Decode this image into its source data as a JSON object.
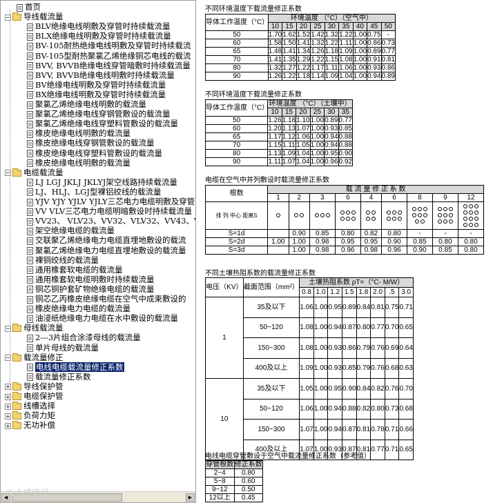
{
  "tree": {
    "items": [
      {
        "label": "首页",
        "level": 1,
        "type": "doc"
      },
      {
        "label": "导线载流量",
        "level": 0,
        "type": "folder",
        "expanded": true
      },
      {
        "label": "BLV绝缘电线明敷及穿管时持续载流量",
        "level": 2,
        "type": "doc"
      },
      {
        "label": "BLX绝缘电线明敷及穿管时持续载流量",
        "level": 2,
        "type": "doc"
      },
      {
        "label": "BV-105耐热绝缘电线明敷及穿管时持续载流",
        "level": 2,
        "type": "doc"
      },
      {
        "label": "BV-105型耐热聚氯乙烯绝缘铜芯电线的载流",
        "level": 2,
        "type": "doc"
      },
      {
        "label": "BVV, BVVB绝缘电线穿管暗敷时持续载流量",
        "level": 2,
        "type": "doc"
      },
      {
        "label": "BVV, BVVB绝缘电线明敷时持续载流量",
        "level": 2,
        "type": "doc"
      },
      {
        "label": "BV绝缘电线明敷及穿管时持续载流量",
        "level": 2,
        "type": "doc"
      },
      {
        "label": "BX绝缘电线明敷及穿管时持续载流量",
        "level": 2,
        "type": "doc"
      },
      {
        "label": "聚氯乙烯绝缘电线明敷的载流量",
        "level": 2,
        "type": "doc"
      },
      {
        "label": "聚氯乙烯绝缘电线穿钢管敷设的载流量",
        "level": 2,
        "type": "doc"
      },
      {
        "label": "聚氯乙烯绝缘电线穿塑料管敷设的载流量",
        "level": 2,
        "type": "doc"
      },
      {
        "label": "橡皮绝缘电线明敷的载流量",
        "level": 2,
        "type": "doc"
      },
      {
        "label": "橡皮绝缘电线穿钢管敷设的载流量",
        "level": 2,
        "type": "doc"
      },
      {
        "label": "橡皮绝缘电线穿塑料管敷设的载流量",
        "level": 2,
        "type": "doc"
      },
      {
        "label": "橡皮绝缘电线明敷的载流量",
        "level": 2,
        "type": "doc"
      },
      {
        "label": "电缆载流量",
        "level": 0,
        "type": "folder",
        "expanded": true
      },
      {
        "label": "LJ LGJ JKLJ JKLYJ架空线路持续载流量",
        "level": 2,
        "type": "doc"
      },
      {
        "label": "LJ、HLJ、LGJ型裸铝绞线的载流量",
        "level": 2,
        "type": "doc"
      },
      {
        "label": "YJV YJY YJLV YJLY三芯电力电缆明敷及穿管",
        "level": 2,
        "type": "doc"
      },
      {
        "label": "VV VLV三芯电力电缆明暗敷设时持续载流量",
        "level": 2,
        "type": "doc"
      },
      {
        "label": "VV23、 VLV23、VV32、VLV32、VV43、VLV43",
        "level": 2,
        "type": "doc"
      },
      {
        "label": "架空绝缘电缆的载流量",
        "level": 2,
        "type": "doc"
      },
      {
        "label": "交联聚乙烯绝缘电力电缆直埋地敷设的载流",
        "level": 2,
        "type": "doc"
      },
      {
        "label": "聚氯乙烯绝缘电力电缆直埋地敷设的载流量",
        "level": 2,
        "type": "doc"
      },
      {
        "label": "裸铜绞线的载流量",
        "level": 2,
        "type": "doc"
      },
      {
        "label": "通用橡套软电缆的载流量",
        "level": 2,
        "type": "doc"
      },
      {
        "label": "通用橡套软电缆明敷时持续载流量",
        "level": 2,
        "type": "doc"
      },
      {
        "label": "铜芯铜护套矿物绝缘电缆的载流量",
        "level": 2,
        "type": "doc"
      },
      {
        "label": "铜芯乙丙橡皮绝缘电缆在空气中成束敷设的",
        "level": 2,
        "type": "doc"
      },
      {
        "label": "橡皮绝缘电力电缆的载流量",
        "level": 2,
        "type": "doc"
      },
      {
        "label": "油浸纸绝缘电力电缆在水中敷设的载流量",
        "level": 2,
        "type": "doc"
      },
      {
        "label": "母线载流量",
        "level": 0,
        "type": "folder",
        "expanded": true
      },
      {
        "label": "2---3片组合涂漆母线的载流量",
        "level": 2,
        "type": "doc"
      },
      {
        "label": "单片母线的载流量",
        "level": 2,
        "type": "doc"
      },
      {
        "label": "载流量修正",
        "level": 0,
        "type": "folder",
        "expanded": true
      },
      {
        "label": "电线电缆载流量修正系数",
        "level": 2,
        "type": "doc",
        "selected": true
      },
      {
        "label": "载流量修正系数",
        "level": 2,
        "type": "doc"
      },
      {
        "label": "导线保护管",
        "level": 0,
        "type": "folder",
        "expanded": false
      },
      {
        "label": "电缆保护管",
        "level": 0,
        "type": "folder",
        "expanded": false
      },
      {
        "label": "线槽选择",
        "level": 0,
        "type": "folder",
        "expanded": false
      },
      {
        "label": "负荷力矩",
        "level": 0,
        "type": "folder",
        "expanded": false
      },
      {
        "label": "无功补偿",
        "level": 0,
        "type": "folder",
        "expanded": false
      }
    ]
  },
  "watermark": "大成培训",
  "t1": {
    "caption": "不同环境温度下载流量修正系数",
    "head_left": "导体工作温度（°C）",
    "head_top": "环境温度 （°C）（空气中）",
    "cols": [
      "10",
      "15",
      "20",
      "25",
      "30",
      "35",
      "40",
      "45",
      "50"
    ],
    "rows": [
      [
        "50",
        "1.70",
        "1.62",
        "1.52",
        "1.42",
        "1.32",
        "1.22",
        "1.00",
        "0.75",
        "-"
      ],
      [
        "60",
        "1.58",
        "1.50",
        "1.41",
        "1.32",
        "1.22",
        "1.11",
        "1.00",
        "0.86",
        "0.73"
      ],
      [
        "65",
        "1.48",
        "1.41",
        "1.34",
        "1.26",
        "1.18",
        "1.09",
        "1.00",
        "0.89",
        "0.77"
      ],
      [
        "70",
        "1.41",
        "1.35",
        "1.29",
        "1.22",
        "1.15",
        "1.08",
        "1.00",
        "0.91",
        "0.81"
      ],
      [
        "80",
        "1.32",
        "1.27",
        "1.22",
        "1.17",
        "1.11",
        "1.06",
        "1.00",
        "0.93",
        "0.86"
      ],
      [
        "90",
        "1.26",
        "1.22",
        "1.18",
        "1.14",
        "1.09",
        "1.04",
        "1.00",
        "0.94",
        "0.89"
      ]
    ]
  },
  "t2": {
    "caption": "不同环境温度下载流量修正系数",
    "head_left": "导体工作温度（°C）",
    "head_top": "环境温度 （°C）（土壤中）",
    "cols": [
      "10",
      "15",
      "20",
      "25",
      "30",
      "35"
    ],
    "rows": [
      [
        "50",
        "1.26",
        "1.18",
        "1.10",
        "1.00",
        "0.89",
        "0.77"
      ],
      [
        "60",
        "1.20",
        "1.13",
        "1.07",
        "1.00",
        "0.93",
        "0.85"
      ],
      [
        "65",
        "1.17",
        "1.12",
        "1.06",
        "1.00",
        "0.94",
        "0.88"
      ],
      [
        "70",
        "1.15",
        "1.11",
        "1.05",
        "1.00",
        "0.94",
        "0.88"
      ],
      [
        "80",
        "1.13",
        "1.09",
        "1.04",
        "1.00",
        "0.95",
        "0.90"
      ],
      [
        "90",
        "1.11",
        "1.07",
        "1.04",
        "1.00",
        "0.96",
        "0.92"
      ]
    ]
  },
  "t3": {
    "caption": "电缆在空气中并列敷设时载流量修正系数",
    "head_left": "根数",
    "head_top": "载 流 量 修 正 系 数",
    "cols": [
      "1",
      "2",
      "3",
      "6",
      "4",
      "6",
      "8",
      "9",
      "12"
    ],
    "arr_label": "排 列 中心 距离S",
    "rows": [
      [
        "S=1d",
        "",
        "0.90",
        "0.85",
        "0.80",
        "0.82",
        "0.80",
        "-",
        "-",
        "-"
      ],
      [
        "S=2d",
        "1.00",
        "1.00",
        "0.98",
        "0.95",
        "0.95",
        "0.90",
        "0.85",
        "0.80",
        "0.80"
      ],
      [
        "S=3d",
        "",
        "1.00",
        "0.98",
        "0.96",
        "0.98",
        "0.96",
        "0.90",
        "0.85",
        "0.80"
      ]
    ]
  },
  "t4": {
    "caption": "不同土壤热阻系数的载流量修正系数",
    "head_v": "电压（KV）",
    "head_area": "截面范围（mm²）",
    "head_top": "土壤热阻系数 ρT=（°C- M/W）",
    "cols": [
      "0.8",
      "1.0",
      "1.2",
      "1.5",
      "1.8",
      "2.0",
      ".5",
      "3.0"
    ],
    "groups": [
      {
        "v": "1",
        "rows": [
          [
            "35及以下",
            "1.06",
            "1.00",
            "0.95",
            "0.89",
            "0.84",
            "0.81",
            "0.75",
            "0.71"
          ],
          [
            "50~120",
            "1.08",
            "1.00",
            "0.94",
            "0.87",
            "0.80",
            "0.77",
            "0.70",
            "0.65"
          ],
          [
            "150~300",
            "1.08",
            "1.00",
            "0.93",
            "0.86",
            "0.79",
            "0.76",
            "0.69",
            "0.64"
          ],
          [
            "400及以上",
            "1.09",
            "1.00",
            "0.93",
            "0.85",
            "0.79",
            "0.76",
            "0.68",
            "0.63"
          ]
        ]
      },
      {
        "v": "10",
        "rows": [
          [
            "35及以下",
            "1.05",
            "1.00",
            "0.95",
            "0.90",
            "0.84",
            "0.82",
            "0.76",
            "0.70"
          ],
          [
            "50~120",
            "1.06",
            "1.00",
            "0.94",
            "0.88",
            "0.82",
            "0.80",
            "0.73",
            "0.68"
          ],
          [
            "150~300",
            "1.07",
            "1.00",
            "0.94",
            "0.87",
            "0.81",
            "0.78",
            "0.71",
            "0.66"
          ],
          [
            "400及以上",
            "1.07",
            "1.00",
            "0.93",
            "0.87",
            "0.81",
            "0.77",
            "0.71",
            "0.65"
          ]
        ]
      }
    ]
  },
  "t5": {
    "caption": "电线电缆穿管敷设于空气中载流量修正系数（参考值）",
    "head_a": "穿管根数",
    "head_b": "修正系数",
    "rows": [
      [
        "2~4",
        "0.80"
      ],
      [
        "5~8",
        "0.60"
      ],
      [
        "9~12",
        "0.50"
      ],
      [
        "12以上",
        "0.45"
      ]
    ]
  }
}
